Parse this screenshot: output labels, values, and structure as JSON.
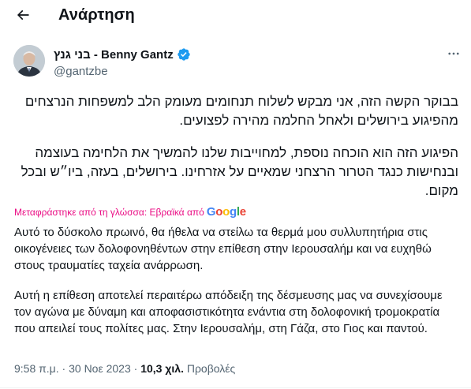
{
  "header": {
    "title": "Ανάρτηση",
    "back_icon": "arrow-left-icon"
  },
  "author": {
    "name": "בני גנץ - Benny Gantz",
    "handle": "@gantzbe",
    "verified": true,
    "verified_color": "#1d9bf0"
  },
  "tweet": {
    "hebrew_paragraphs": [
      "בבוקר הקשה הזה, אני מבקש לשלוח תנחומים מעומק הלב למשפחות הנרצחים מהפיגוע בירושלים ולאחל החלמה מהירה לפצועים.",
      "הפיגוע הזה הוא הוכחה נוספת, למחוייבות שלנו להמשיך את הלחימה בעוצמה ובנחישות כנגד הטרור הרצחני שמאיים על אזרחינו. בירושלים, בעזה, ביו״ש ובכל מקום."
    ],
    "translation_notice": "Μεταφράστηκε από τη γλώσσα: Εβραϊκά από",
    "translation_provider": "Google",
    "greek_paragraphs": [
      "Αυτό το δύσκολο πρωινό, θα ήθελα να στείλω τα θερμά μου συλλυπητήρια στις οικογένειες των δολοφονηθέντων στην επίθεση στην Ιερουσαλήμ και να ευχηθώ στους τραυματίες ταχεία ανάρρωση.",
      "Αυτή η επίθεση αποτελεί περαιτέρω απόδειξη της δέσμευσης μας να συνεχίσουμε τον αγώνα με δύναμη και αποφασιστικότητα ενάντια στη δολοφονική τρομοκρατία που απειλεί τους πολίτες μας. Στην Ιερουσαλήμ, στη Γάζα, στο Γιος και παντού."
    ]
  },
  "meta": {
    "time": "9:58 π.μ.",
    "separator": " · ",
    "date": "30 Νοε 2023",
    "views_count": "10,3 χιλ.",
    "views_label": "Προβολές"
  },
  "colors": {
    "accent": "#1d9bf0",
    "translation": "#ea0d84",
    "secondary_text": "#536471"
  },
  "icons": {
    "more": "more-horizontal-icon",
    "verified": "verified-badge-icon"
  }
}
